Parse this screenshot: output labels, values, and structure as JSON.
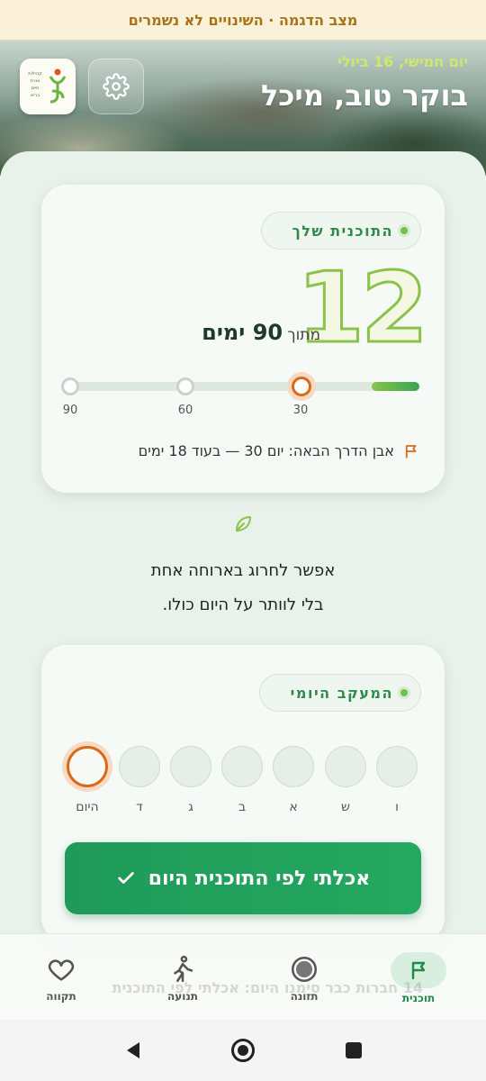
{
  "banner": {
    "text": "מצב הדגמה · השינויים לא נשמרים"
  },
  "header": {
    "date": "יום חמישי, 16 ביולי",
    "greeting": "בוקר טוב, מיכל",
    "logo_text": [
      "קהילות",
      "אורח",
      "חיים",
      "בריא"
    ]
  },
  "plan": {
    "pill_label": "התוכנית שלך",
    "current_day": "12",
    "of_label": "מתוך",
    "total_days": "90 ימים",
    "progress_fraction": 0.1333,
    "milestones": [
      "30",
      "60",
      "90"
    ],
    "active_milestone": "30",
    "next_milestone_text": "אבן הדרך הבאה: יום 30 — בעוד 18 ימים"
  },
  "quote": {
    "line1": "אפשר לחרוג בארוחה אחת",
    "line2": "בלי לוותר על היום כולו."
  },
  "tracker": {
    "pill_label": "המעקב היומי",
    "days": [
      "היום",
      "ד",
      "ג",
      "ב",
      "א",
      "ש",
      "ו"
    ],
    "today_label": "היום",
    "button_label": "אכלתי לפי התוכנית היום"
  },
  "ghost_notice": "14 חברות כבר סימנו היום: אכלתי לפי התוכנית",
  "bottom_nav": {
    "items": [
      {
        "label": "תוכנית",
        "icon": "flag-icon",
        "active": true
      },
      {
        "label": "תזונה",
        "icon": "target-icon",
        "active": false
      },
      {
        "label": "תנועה",
        "icon": "walking-icon",
        "active": false
      },
      {
        "label": "תקווה",
        "icon": "heart-icon",
        "active": false
      }
    ]
  },
  "colors": {
    "primary_green": "#24a85f",
    "accent_orange": "#d96a1a",
    "lime": "#8bc34a"
  }
}
